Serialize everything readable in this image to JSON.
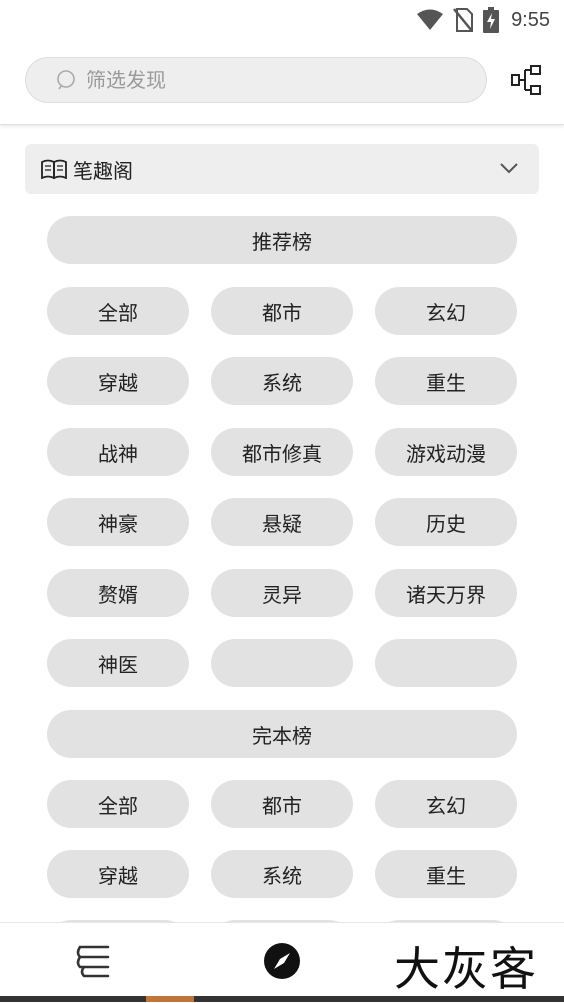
{
  "status_bar": {
    "time": "9:55",
    "icons": [
      "wifi-icon",
      "no-sim-icon",
      "battery-charging-icon"
    ]
  },
  "header": {
    "search_placeholder": "筛选发现",
    "tree_icon": "tree-structure-icon"
  },
  "source": {
    "icon": "open-book-icon",
    "label": "笔趣阁"
  },
  "sections": [
    {
      "title": "推荐榜",
      "chips": [
        "全部",
        "都市",
        "玄幻",
        "穿越",
        "系统",
        "重生",
        "战神",
        "都市修真",
        "游戏动漫",
        "神豪",
        "悬疑",
        "历史",
        "赘婿",
        "灵异",
        "诸天万界",
        "神医",
        "",
        ""
      ]
    },
    {
      "title": "完本榜",
      "chips": [
        "全部",
        "都市",
        "玄幻",
        "穿越",
        "系统",
        "重生",
        "",
        "",
        ""
      ]
    }
  ],
  "bottom_nav": {
    "items": [
      "bookshelf-icon",
      "compass-icon"
    ],
    "watermark": "大灰客"
  },
  "colors": {
    "chip_bg": "#e2e2e2",
    "search_bg": "#eeeeee",
    "accent": "#c0763a"
  }
}
